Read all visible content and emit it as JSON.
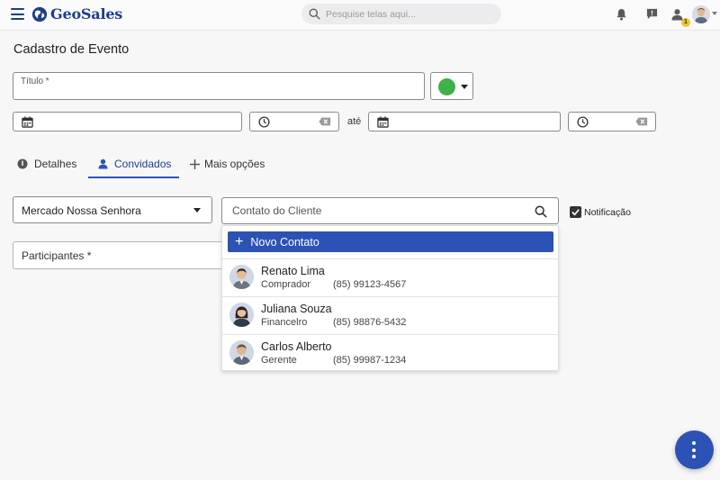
{
  "app": {
    "brand": "GeoSales",
    "search_placeholder": "Pesquise telas aqui...",
    "notification_count": "1"
  },
  "page": {
    "title": "Cadastro de Evento",
    "title_field_label": "Título *",
    "event_color": "#3fb04a",
    "date_separator": "até"
  },
  "tabs": [
    {
      "label": "Detalhes"
    },
    {
      "label": "Convidados",
      "active": true
    },
    {
      "label": "Mais opções"
    }
  ],
  "form": {
    "store_value": "Mercado Nossa Senhora",
    "contact_placeholder": "Contato do Cliente",
    "notification_label": "Notificação",
    "notification_checked": true,
    "participants_label": "Participantes *"
  },
  "dropdown": {
    "new_contact_label": "Novo Contato",
    "contacts": [
      {
        "name": "Renato Lima",
        "role": "Comprador",
        "phone": "(85) 99123-4567"
      },
      {
        "name": "Juliana Souza",
        "role": "Financelro",
        "phone": "(85) 98876-5432"
      },
      {
        "name": "Carlos Alberto",
        "role": "Gerente",
        "phone": "(85) 99987-1234"
      }
    ]
  },
  "colors": {
    "brand": "#1d3f8a",
    "accent": "#2c52b5"
  }
}
